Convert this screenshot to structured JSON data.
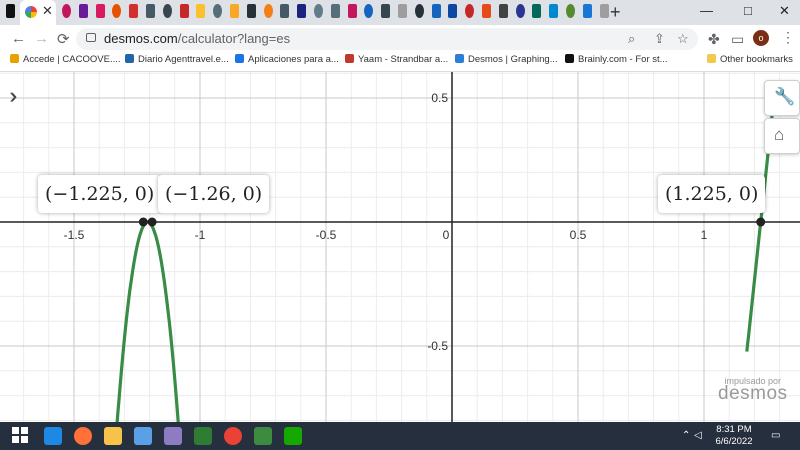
{
  "browser": {
    "active_tab_close": "✕",
    "new_tab": "+",
    "url_host": "desmos.com",
    "url_path": "/calculator?lang=es",
    "profile_initial": "o",
    "window_controls": [
      "—",
      "□",
      "✕"
    ]
  },
  "bookmarks": [
    {
      "label": "Accede | CACOOVE....",
      "color": "#e8a200"
    },
    {
      "label": "Diario Agenttravel.e...",
      "color": "#2266aa"
    },
    {
      "label": "Aplicaciones para a...",
      "color": "#1a73e8"
    },
    {
      "label": "Yaam - Strandbar a...",
      "color": "#c0392b"
    },
    {
      "label": "Desmos | Graphing...",
      "color": "#2c7fd6"
    },
    {
      "label": "Brainly.com - For st...",
      "color": "#111111"
    },
    {
      "label": "Other bookmarks",
      "color": "#f2c94c"
    }
  ],
  "graph": {
    "x_ticks": [
      "-1.5",
      "-1",
      "-0.5",
      "0",
      "0.5",
      "1"
    ],
    "y_ticks": [
      "0.5",
      "-0.5"
    ],
    "curve_color": "#388c46",
    "points": [
      {
        "label": "(−1.225, 0)",
        "x": -1.225,
        "y": 0
      },
      {
        "label": "(−1.26, 0)",
        "x": -1.19,
        "y": 0
      },
      {
        "label": "(1.225, 0)",
        "x": 1.225,
        "y": 0
      }
    ]
  },
  "watermark": {
    "powered": "impulsado por",
    "brand": "desmos"
  },
  "taskbar": {
    "time": "8:31 PM",
    "date": "6/6/2022",
    "apps": [
      "#1e88e5",
      "#ff7139",
      "#f6c24a",
      "#5aa0e6",
      "#8e7cc3",
      "#2e7d32",
      "#ea4335",
      "#3d8b40",
      "#14a800"
    ]
  }
}
